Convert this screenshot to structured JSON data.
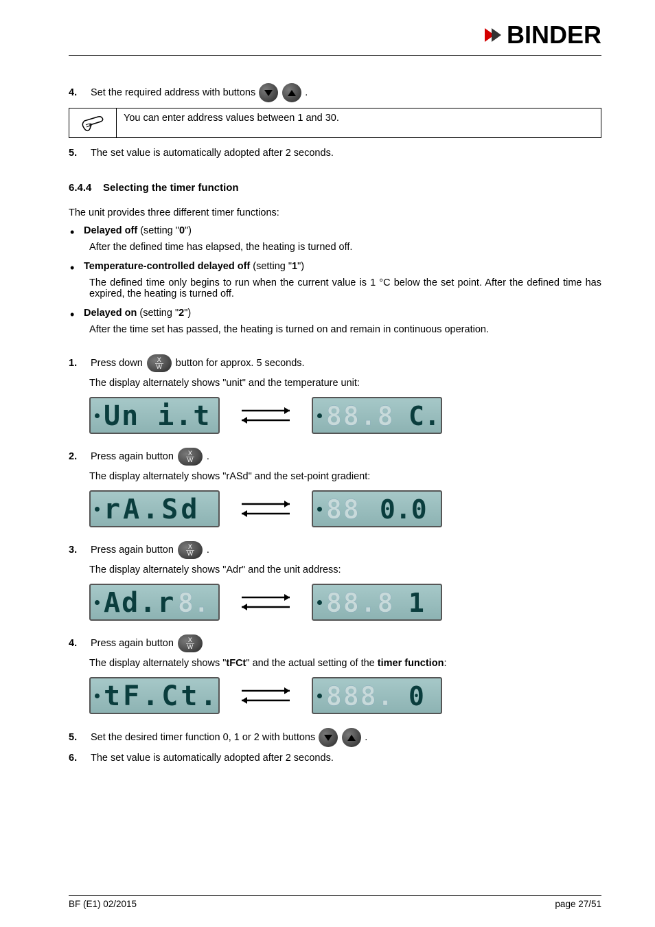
{
  "brand": "BINDER",
  "step4a": {
    "num": "4.",
    "text_before": "Set the required address with buttons",
    "text_after": "."
  },
  "info1": "You can enter address values between 1 and 30.",
  "step5a": {
    "num": "5.",
    "text": "The set value is automatically adopted after 2 seconds."
  },
  "section644": {
    "num": "6.4.4",
    "title": "Selecting the timer function"
  },
  "intro": "The unit provides three different timer functions:",
  "bullet1": {
    "bold": "Delayed off",
    "rest": " (setting \"",
    "setting": "0",
    "rest2": "\")"
  },
  "bullet1_sub": "After the defined time has elapsed, the heating is turned off.",
  "bullet2": {
    "bold": "Temperature-controlled delayed off",
    "rest": " (setting \"",
    "setting": "1",
    "rest2": "\")"
  },
  "bullet2_sub": "The defined time only begins to run when the current value is 1 °C below the set point. After the defined time has expired, the heating is turned off.",
  "bullet3": {
    "bold": "Delayed on",
    "rest": " (setting \"",
    "setting": "2",
    "rest2": "\")"
  },
  "bullet3_sub": "After the time set has passed, the heating is turned on and remain in continuous operation.",
  "proc1": {
    "num": "1.",
    "text_before": "Press down",
    "text_after": "button for approx. 5 seconds."
  },
  "proc1_sub": "The display alternately shows \"unit\" and the temperature unit:",
  "proc2": {
    "num": "2.",
    "text_before": "Press again button",
    "text_after": "."
  },
  "proc2_sub": "The display alternately shows \"rASd\" and the set-point gradient:",
  "proc3": {
    "num": "3.",
    "text_before": "Press again button",
    "text_after": "."
  },
  "proc3_sub": "The display alternately shows \"Adr\" and the unit address:",
  "proc4": {
    "num": "4.",
    "text_before": "Press again button",
    "text_after": ""
  },
  "proc4_sub_a": "The display alternately shows \"",
  "proc4_sub_bold1": "tFCt",
  "proc4_sub_b": "\" and the actual setting of the ",
  "proc4_sub_bold2": "timer function",
  "proc4_sub_c": ":",
  "proc5": {
    "num": "5.",
    "text_before": "Set the desired timer function 0, 1 or 2 with buttons",
    "text_after": "."
  },
  "proc6": {
    "num": "6.",
    "text": "The set value is automatically adopted after 2 seconds."
  },
  "footer_left": "BF (E1) 02/2015",
  "footer_right": "page 27/51"
}
